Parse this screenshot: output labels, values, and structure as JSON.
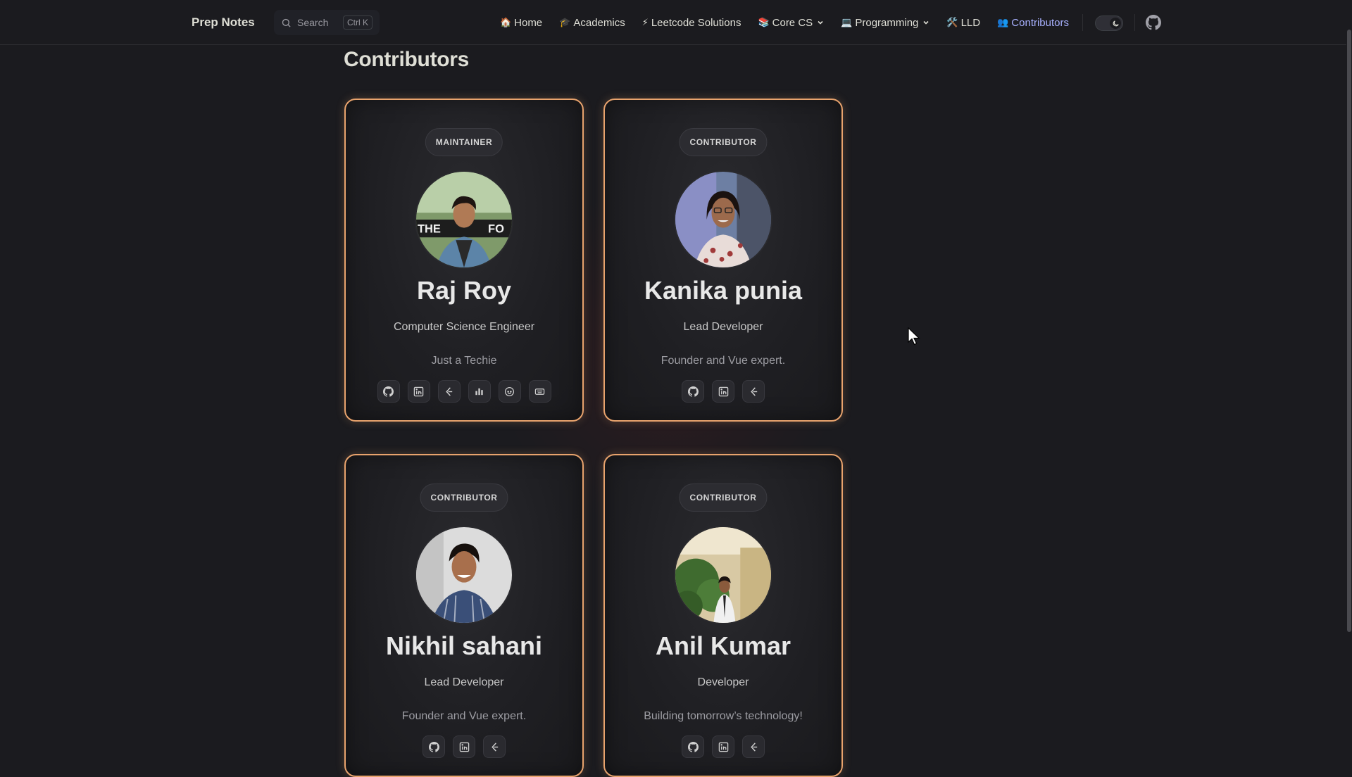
{
  "navbar": {
    "brand": "Prep Notes",
    "search_placeholder": "Search",
    "search_shortcut": "Ctrl K",
    "links": [
      {
        "emoji": "🏠",
        "label": "Home",
        "dropdown": false,
        "active": false
      },
      {
        "emoji": "🎓",
        "label": "Academics",
        "dropdown": false,
        "active": false
      },
      {
        "emoji": "⚡",
        "label": "Leetcode Solutions",
        "dropdown": false,
        "active": false
      },
      {
        "emoji": "📚",
        "label": "Core CS",
        "dropdown": true,
        "active": false
      },
      {
        "emoji": "💻",
        "label": "Programming",
        "dropdown": true,
        "active": false
      },
      {
        "emoji": "🛠️",
        "label": "LLD",
        "dropdown": false,
        "active": false
      },
      {
        "emoji": "👥",
        "label": "Contributors",
        "dropdown": false,
        "active": true
      }
    ],
    "theme_toggle_icon": "moon-icon",
    "github_icon": "github-icon"
  },
  "page": {
    "title": "Contributors"
  },
  "contributors": [
    {
      "badge": "MAINTAINER",
      "name": "Raj Roy",
      "role": "Computer Science Engineer",
      "bio": "Just a Techie",
      "socials": [
        "github-icon",
        "linkedin-icon",
        "leetcode-icon",
        "chart-icon",
        "reddit-icon",
        "keyboard-icon"
      ]
    },
    {
      "badge": "CONTRIBUTOR",
      "name": "Kanika punia",
      "role": "Lead Developer",
      "bio": "Founder and Vue expert.",
      "socials": [
        "github-icon",
        "linkedin-icon",
        "leetcode-icon"
      ]
    },
    {
      "badge": "CONTRIBUTOR",
      "name": "Nikhil sahani",
      "role": "Lead Developer",
      "bio": "Founder and Vue expert.",
      "socials": [
        "github-icon",
        "linkedin-icon",
        "leetcode-icon"
      ]
    },
    {
      "badge": "CONTRIBUTOR",
      "name": "Anil Kumar",
      "role": "Developer",
      "bio": "Building tomorrow’s technology!",
      "socials": [
        "github-icon",
        "linkedin-icon",
        "leetcode-icon"
      ]
    }
  ],
  "colors": {
    "background": "#1b1b1f",
    "card_border": "#e8a36d",
    "active_link": "#a8b1ff"
  }
}
